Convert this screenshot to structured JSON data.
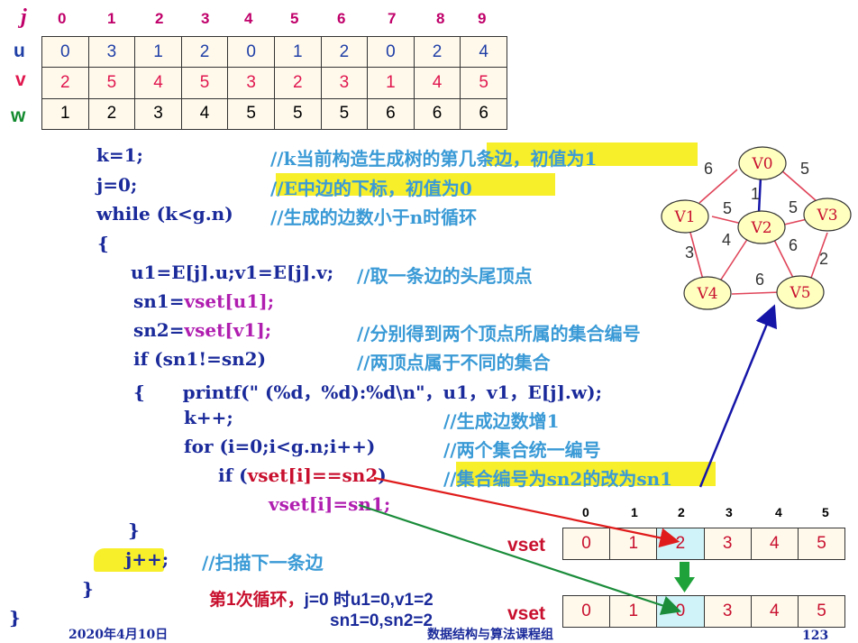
{
  "edge_table": {
    "j_label": "j",
    "headers": [
      "0",
      "1",
      "2",
      "3",
      "4",
      "5",
      "6",
      "7",
      "8",
      "9"
    ],
    "rows": [
      {
        "label": "u",
        "values": [
          "0",
          "3",
          "1",
          "2",
          "0",
          "1",
          "2",
          "0",
          "2",
          "4"
        ]
      },
      {
        "label": "v",
        "values": [
          "2",
          "5",
          "4",
          "5",
          "3",
          "2",
          "3",
          "1",
          "4",
          "5"
        ]
      },
      {
        "label": "w",
        "values": [
          "1",
          "2",
          "3",
          "4",
          "5",
          "5",
          "5",
          "6",
          "6",
          "6"
        ]
      }
    ]
  },
  "code": {
    "l1": "k=1;",
    "l1c": "//k当前构造生成树的第几条边，初值为1",
    "l2": "j=0;",
    "l2c": "//E中边的下标，初值为0",
    "l3": "while (k<g.n)",
    "l3c": "//生成的边数小于n时循环",
    "l4": "{",
    "l5": "u1=E[j].u;v1=E[j].v;",
    "l5c": "//取一条边的头尾顶点",
    "l6a": "sn1=",
    "l6b": "vset[u1];",
    "l7a": "sn2=",
    "l7b": "vset[v1];",
    "l7c": "//分别得到两个顶点所属的集合编号",
    "l8": "if (sn1!=sn2)",
    "l8c": "//两顶点属于不同的集合",
    "l9": "{      printf(\" (%d，%d):%d\\n\"，u1，v1，E[j].w);",
    "l10": "k++;",
    "l10c": "//生成边数增1",
    "l11": "for (i=0;i<g.n;i++)",
    "l11c": "//两个集合统一编号",
    "l12a": "if (",
    "l12b": "vset[i]==sn2",
    "l12c": ")",
    "l12cm": "//集合编号为sn2的改为sn1",
    "l13": "vset[i]=sn1;",
    "l14": "}",
    "l15": "j++;",
    "l15c": "//扫描下一条边",
    "l16": "}",
    "l17": "}"
  },
  "graph": {
    "nodes": [
      "V0",
      "V1",
      "V2",
      "V3",
      "V4",
      "V5"
    ],
    "weights": [
      "6",
      "5",
      "1",
      "5",
      "5",
      "4",
      "6",
      "3",
      "6",
      "2"
    ]
  },
  "vset": {
    "label": "vset",
    "headers": [
      "0",
      "1",
      "2",
      "3",
      "4",
      "5"
    ],
    "before": [
      "0",
      "1",
      "2",
      "3",
      "4",
      "5"
    ],
    "after": [
      "0",
      "1",
      "0",
      "3",
      "4",
      "5"
    ]
  },
  "loop_note": {
    "prefix": "第",
    "num": "1",
    "suffix": "次循环，",
    "detail1": "j=0 时u1=0,v1=2",
    "detail2": "sn1=0,sn2=2"
  },
  "footer": {
    "date": "2020年4月10日",
    "course": "数据结构与算法课程组",
    "page": "123"
  },
  "colors": {
    "highlight": "#f7ef2a",
    "node_fill": "#ffffc0",
    "graph_edge": "#e0455a",
    "red_arrow": "#e01b1b",
    "green_arrow": "#1a8c3a",
    "blue_arrow": "#1515a8"
  }
}
